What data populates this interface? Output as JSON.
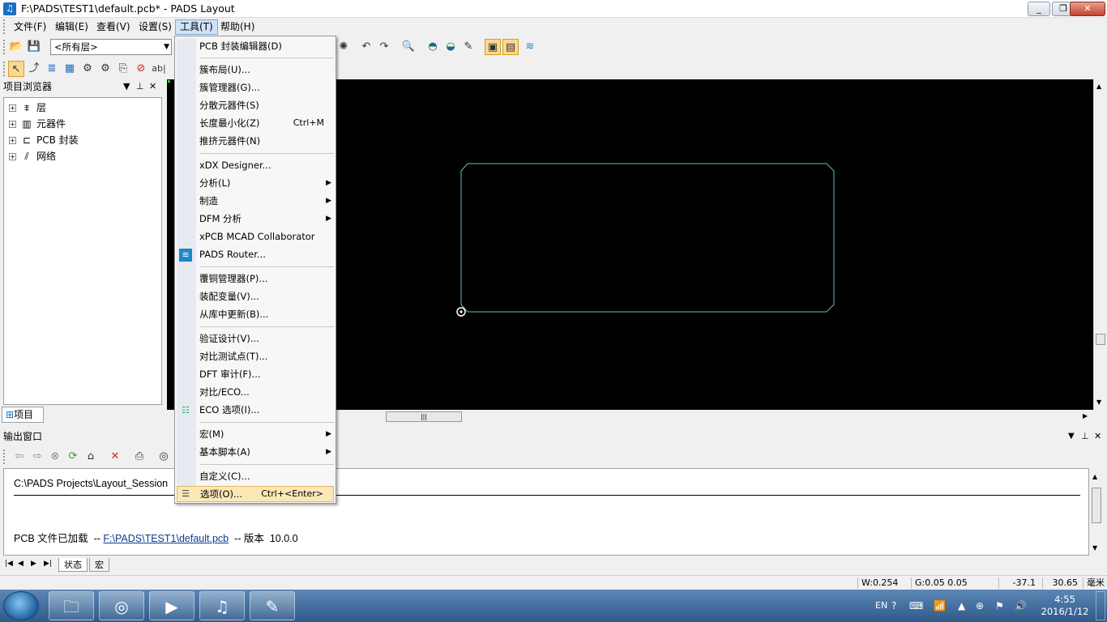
{
  "window": {
    "title": "F:\\PADS\\TEST1\\default.pcb* - PADS Layout",
    "minimize": "_",
    "maximize": "❐",
    "close": "✕"
  },
  "menubar": {
    "file": "文件(F)",
    "edit": "编辑(E)",
    "view": "查看(V)",
    "settings": "设置(S)",
    "tools": "工具(T)",
    "help": "帮助(H)"
  },
  "toolbar": {
    "layer_select": "<所有层>"
  },
  "project_browser": {
    "title": "项目浏览器",
    "tree": [
      {
        "label": "层"
      },
      {
        "label": "元器件"
      },
      {
        "label": "PCB 封装"
      },
      {
        "label": "网络"
      }
    ],
    "tab": "项目"
  },
  "tools_menu": {
    "items": [
      {
        "label": "PCB 封装编辑器(D)"
      },
      {
        "label": "簇布局(U)..."
      },
      {
        "label": "簇管理器(G)..."
      },
      {
        "label": "分散元器件(S)"
      },
      {
        "label": "长度最小化(Z)",
        "shortcut": "Ctrl+M"
      },
      {
        "label": "推挤元器件(N)"
      },
      {
        "label": "xDX Designer..."
      },
      {
        "label": "分析(L)"
      },
      {
        "label": "制造"
      },
      {
        "label": "DFM 分析"
      },
      {
        "label": "xPCB MCAD Collaborator"
      },
      {
        "label": "PADS Router..."
      },
      {
        "label": "覆铜管理器(P)..."
      },
      {
        "label": "装配变量(V)..."
      },
      {
        "label": "从库中更新(B)..."
      },
      {
        "label": "验证设计(V)..."
      },
      {
        "label": "对比测试点(T)..."
      },
      {
        "label": "DFT 审计(F)..."
      },
      {
        "label": "对比/ECO..."
      },
      {
        "label": "ECO 选项(I)..."
      },
      {
        "label": "宏(M)"
      },
      {
        "label": "基本脚本(A)"
      },
      {
        "label": "自定义(C)..."
      },
      {
        "label": "选项(O)...",
        "shortcut": "Ctrl+<Enter>"
      }
    ]
  },
  "output": {
    "title": "输出窗口",
    "line1": "C:\\PADS Projects\\Layout_Session",
    "line2_prefix": "PCB 文件已加载  -- ",
    "line2_link": "F:\\PADS\\TEST1\\default.pcb",
    "line2_suffix": "  -- 版本  10.0.0",
    "tabs": [
      "状态",
      "宏"
    ]
  },
  "statusbar": {
    "width": "W:0.254",
    "grid": "G:0.05 0.05",
    "x": "-37.1",
    "y": "30.65",
    "units": "毫米"
  },
  "taskbar": {
    "lang": "EN",
    "time": "4:55",
    "date": "2016/1/12"
  },
  "colors": {
    "board_outline": "#4fc3c7",
    "canvas_bg": "#000000",
    "menu_highlight": "#fbe7b8"
  }
}
